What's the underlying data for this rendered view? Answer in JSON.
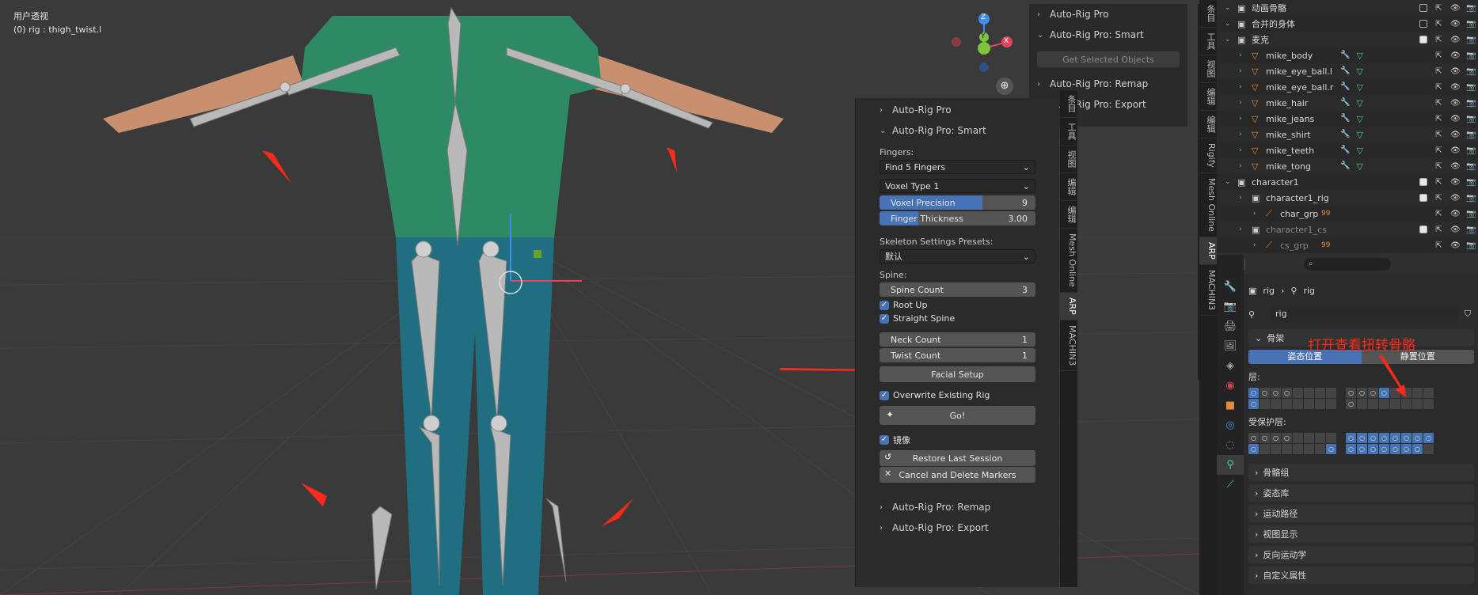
{
  "viewport": {
    "mode_label": "用户透视",
    "object_label": "(0) rig : thigh_twist.l",
    "gizmo": {
      "z": "Z",
      "y": "Y",
      "x": "X"
    }
  },
  "npanel_back": {
    "headers": [
      "Auto-Rig Pro",
      "Auto-Rig Pro: Smart",
      "Auto-Rig Pro: Remap",
      "Auto-Rig Pro: Export"
    ],
    "get_selected_objects": "Get Selected Objects"
  },
  "npanel_back_tabs": [
    "条目",
    "工具",
    "视图",
    "编辑",
    "编辑",
    "Rigify",
    "Mesh Online",
    "ARP",
    "MACHIN3"
  ],
  "npanel": {
    "header_arp": "Auto-Rig Pro",
    "header_smart": "Auto-Rig Pro: Smart",
    "fingers_label": "Fingers:",
    "fingers_select": "Find 5 Fingers",
    "voxel_select": "Voxel Type 1",
    "voxel_precision_label": "Voxel Precision",
    "voxel_precision_value": "9",
    "voxel_precision_fraction": 0.66,
    "finger_thickness_label": "Finger Thickness",
    "finger_thickness_value": "3.00",
    "finger_thickness_fraction": 0.25,
    "skeleton_presets_label": "Skeleton Settings Presets:",
    "skeleton_presets_value": "默认",
    "spine_label": "Spine:",
    "spine_count_label": "Spine Count",
    "spine_count_value": "3",
    "root_up": "Root Up",
    "straight_spine": "Straight Spine",
    "neck_count_label": "Neck Count",
    "neck_count_value": "1",
    "twist_count_label": "Twist Count",
    "twist_count_value": "1",
    "facial_setup": "Facial Setup",
    "overwrite_existing_rig": "Overwrite Existing Rig",
    "go": "Go!",
    "mirror": "镜像",
    "restore_last_session": "Restore Last Session",
    "cancel_delete_markers": "Cancel and Delete Markers",
    "header_remap": "Auto-Rig Pro: Remap",
    "header_export": "Auto-Rig Pro: Export"
  },
  "npanel_tabs": [
    "条目",
    "工具",
    "视图",
    "编辑",
    "编辑",
    "Mesh Online",
    "ARP",
    "MACHIN3"
  ],
  "outliner": {
    "rows": [
      {
        "label": "动画骨骼",
        "indent": 0
      },
      {
        "label": "合并的身体",
        "indent": 0
      },
      {
        "label": "麦克",
        "indent": 0
      },
      {
        "label": "mike_body",
        "indent": 1
      },
      {
        "label": "mike_eye_ball.l",
        "indent": 1
      },
      {
        "label": "mike_eye_ball.r",
        "indent": 1
      },
      {
        "label": "mike_hair",
        "indent": 1
      },
      {
        "label": "mike_jeans",
        "indent": 1
      },
      {
        "label": "mike_shirt",
        "indent": 1
      },
      {
        "label": "mike_teeth",
        "indent": 1
      },
      {
        "label": "mike_tong",
        "indent": 1
      },
      {
        "label": "character1",
        "indent": 0
      },
      {
        "label": "character1_rig",
        "indent": 1
      },
      {
        "label": "char_grp",
        "indent": 2
      },
      {
        "label": "character1_cs",
        "indent": 1
      },
      {
        "label": "cs_grp",
        "indent": 2
      }
    ],
    "badge_99": "99"
  },
  "properties": {
    "breadcrumb_a": "rig",
    "breadcrumb_b": "rig",
    "name_field": "rig",
    "section_skeleton": "骨架",
    "annotation": "打开查看扭转骨骼",
    "pose_position": "姿态位置",
    "rest_position": "静置位置",
    "layers_label": "层:",
    "protected_layers_label": "受保护层:",
    "sections": [
      "骨骼组",
      "姿态库",
      "运动路径",
      "视图显示",
      "反向运动学",
      "自定义属性"
    ]
  },
  "colors": {
    "accent": "#4772b3",
    "shirt": "#2e8a64",
    "jeans": "#1f6f80",
    "annotation_red": "#ff2a1a"
  }
}
